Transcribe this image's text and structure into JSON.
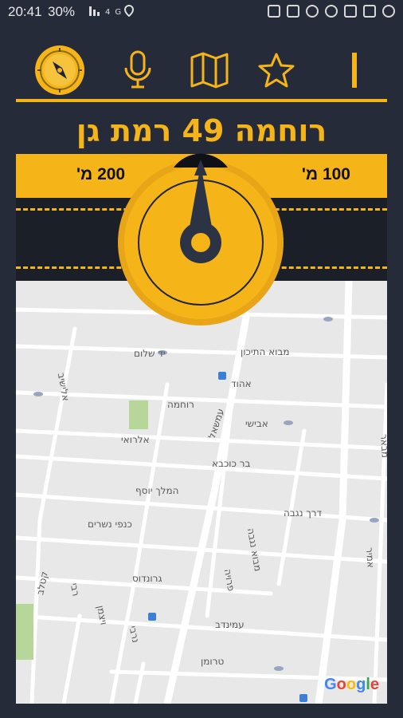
{
  "status_bar": {
    "time": "20:41",
    "battery": "30%",
    "left_icons": [
      "battery-icon",
      "signal-icon",
      "data-icon",
      "location-icon"
    ],
    "right_icons": [
      "notification-icon",
      "voicemail-icon",
      "record-icon",
      "whatsapp-icon",
      "gmail-icon",
      "image-icon",
      "compass-app-icon"
    ]
  },
  "toolbar": {
    "buttons": [
      "compass-icon",
      "microphone-icon",
      "map-icon",
      "star-icon",
      "menu-bar-icon"
    ]
  },
  "address": "רוחמה 49 רמת גן",
  "distances": {
    "left": "200 מ'",
    "right": "100 מ'"
  },
  "map": {
    "streets": [
      {
        "name": "יד שלום"
      },
      {
        "name": "מבוא התיכון"
      },
      {
        "name": "אהוד"
      },
      {
        "name": "רוחמה"
      },
      {
        "name": "אלישיב"
      },
      {
        "name": "עמשאל"
      },
      {
        "name": "אבישי"
      },
      {
        "name": "אלרואי"
      },
      {
        "name": "בר כוכבא"
      },
      {
        "name": "המלך יוסף"
      },
      {
        "name": "דרך נגבה"
      },
      {
        "name": "כנפי נשרים"
      },
      {
        "name": "מבוא נגבה"
      },
      {
        "name": "גרונדוס"
      },
      {
        "name": "פרויה"
      },
      {
        "name": "עמינדב"
      },
      {
        "name": "טרומן"
      },
      {
        "name": "קטלב"
      },
      {
        "name": "רבי"
      },
      {
        "name": "ויצמן"
      },
      {
        "name": "נרבי"
      },
      {
        "name": "אמיר"
      },
      {
        "name": "מבאר"
      }
    ],
    "attribution": "Google"
  },
  "colors": {
    "accent": "#f5b418",
    "background": "#252b38",
    "road_band": "#1b1f27"
  }
}
